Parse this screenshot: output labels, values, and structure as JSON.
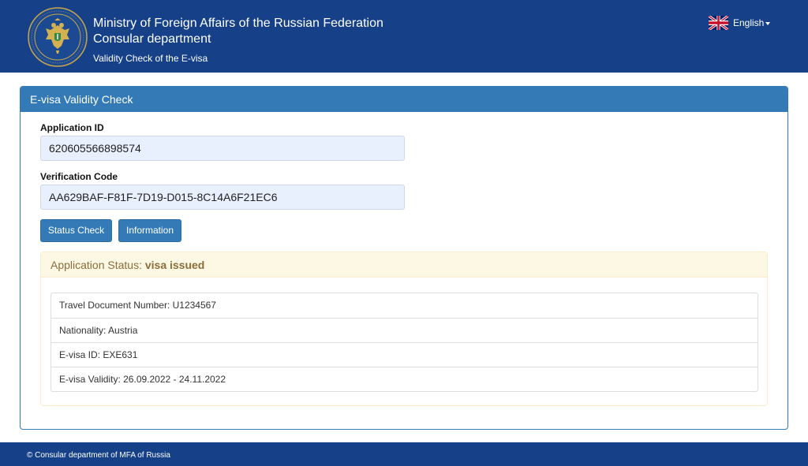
{
  "header": {
    "title": "Ministry of Foreign Affairs of the Russian Federation",
    "subtitle": "Consular department",
    "page_name": "Validity Check of the E-visa",
    "emblem_icon": "mfa-emblem-icon",
    "language": {
      "label": "English",
      "flag_icon": "uk-flag-icon",
      "caret_icon": "caret-down-icon"
    }
  },
  "panel": {
    "heading": "E-visa Validity Check",
    "application_id": {
      "label": "Application ID",
      "value": "620605566898574"
    },
    "verification_code": {
      "label": "Verification Code",
      "value": "AA629BAF-F81F-7D19-D015-8C14A6F21EC6"
    },
    "buttons": {
      "status_check": "Status Check",
      "information": "Information"
    },
    "status": {
      "prefix": "Application Status: ",
      "value": "visa issued",
      "details": [
        "Travel Document Number: U1234567",
        "Nationality: Austria",
        "E-visa ID: EXE631",
        "E-visa Validity: 26.09.2022 - 24.11.2022"
      ]
    }
  },
  "footer": {
    "text": "© Consular department of MFA of Russia"
  },
  "colors": {
    "header_bg": "#164189",
    "primary": "#337ab7",
    "warning_bg": "#fcf8e3",
    "warning_text": "#8a6d3b",
    "input_bg": "#e8f0fe"
  }
}
